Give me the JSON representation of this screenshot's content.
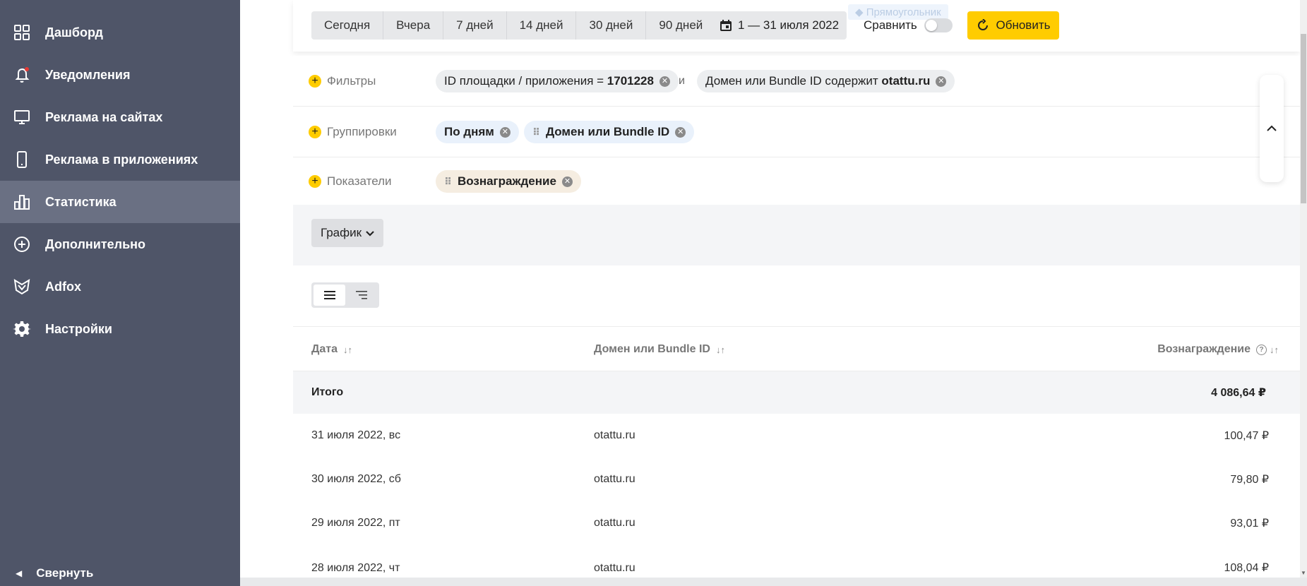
{
  "sidebar": {
    "items": [
      {
        "label": "Дашборд",
        "icon": "grid-icon"
      },
      {
        "label": "Уведомления",
        "icon": "bell-icon"
      },
      {
        "label": "Реклама на сайтах",
        "icon": "monitor-icon"
      },
      {
        "label": "Реклама в приложениях",
        "icon": "phone-icon"
      },
      {
        "label": "Статистика",
        "icon": "bar-chart-icon"
      },
      {
        "label": "Дополнительно",
        "icon": "plus-circle-icon"
      },
      {
        "label": "Adfox",
        "icon": "adfox-logo-icon"
      },
      {
        "label": "Настройки",
        "icon": "gear-icon"
      }
    ],
    "active": "Статистика",
    "collapse_label": "Свернуть",
    "notification_dot_color": "#e53935"
  },
  "toolbar": {
    "periods": [
      "Сегодня",
      "Вчера",
      "7 дней",
      "14 дней",
      "30 дней",
      "90 дней"
    ],
    "date_range": "1 — 31 июля 2022",
    "compare_label": "Сравнить",
    "refresh_label": "Обновить",
    "ghost_label": "Прямоугольник"
  },
  "filters": {
    "label": "Фильтры",
    "chip1_prefix": "ID площадки / приложения = ",
    "chip1_value": "1701228",
    "and_label": "и",
    "chip2_prefix": "Домен или Bundle ID содержит ",
    "chip2_value": "otattu.ru"
  },
  "groupings": {
    "label": "Группировки",
    "chips": [
      "По дням",
      "Домен или Bundle ID"
    ]
  },
  "metrics": {
    "label": "Показатели",
    "chips": [
      "Вознаграждение"
    ]
  },
  "chart_button": "График",
  "table": {
    "columns": [
      "Дата",
      "Домен или Bundle ID",
      "Вознаграждение"
    ],
    "total": {
      "label": "Итого",
      "value": "4 086,64 ₽"
    },
    "rows": [
      {
        "date": "31 июля 2022, вс",
        "domain": "otattu.ru",
        "reward": "100,47 ₽"
      },
      {
        "date": "30 июля 2022, сб",
        "domain": "otattu.ru",
        "reward": "79,80 ₽"
      },
      {
        "date": "29 июля 2022, пт",
        "domain": "otattu.ru",
        "reward": "93,01 ₽"
      },
      {
        "date": "28 июля 2022, чт",
        "domain": "otattu.ru",
        "reward": "108,04 ₽"
      }
    ]
  },
  "colors": {
    "sidebar_bg": "#4f5568",
    "sidebar_active": "#6a7083",
    "accent": "#ffcc00"
  }
}
